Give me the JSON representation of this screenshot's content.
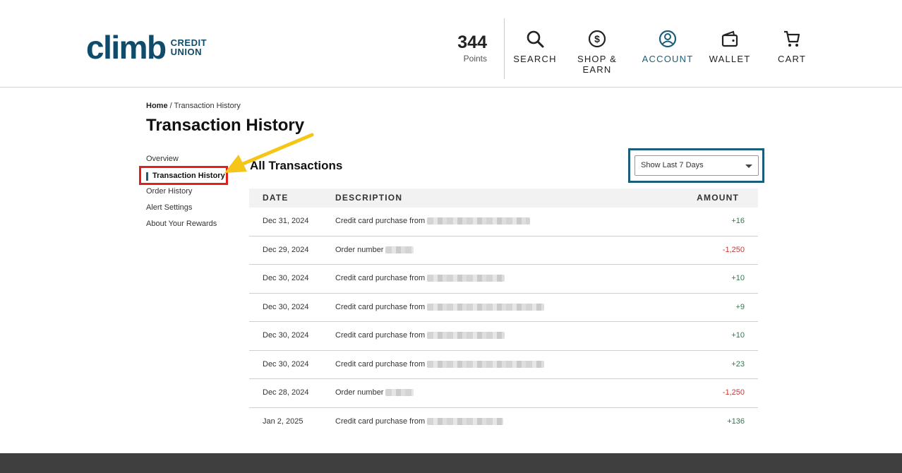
{
  "logo": {
    "main": "climb",
    "sub_line1": "CREDIT",
    "sub_line2": "UNION"
  },
  "points": {
    "value": "344",
    "label": "Points"
  },
  "nav": [
    {
      "label": "SEARCH",
      "icon": "search-icon"
    },
    {
      "label": "SHOP &\nEARN",
      "icon": "dollar-coin-icon"
    },
    {
      "label": "ACCOUNT",
      "icon": "user-circle-icon",
      "active": true
    },
    {
      "label": "WALLET",
      "icon": "wallet-icon"
    },
    {
      "label": "CART",
      "icon": "cart-icon"
    }
  ],
  "breadcrumb": {
    "home": "Home",
    "separator": " / ",
    "current": "Transaction History"
  },
  "page_title": "Transaction History",
  "sidebar": {
    "items": [
      {
        "label": "Overview"
      },
      {
        "label": "Transaction History",
        "active": true
      },
      {
        "label": "Order History"
      },
      {
        "label": "Alert Settings"
      },
      {
        "label": "About Your Rewards"
      }
    ]
  },
  "section_title": "All Transactions",
  "filter": {
    "selected": "Show Last 7 Days"
  },
  "table": {
    "headers": {
      "date": "DATE",
      "description": "DESCRIPTION",
      "amount": "AMOUNT"
    },
    "rows": [
      {
        "date": "Dec 31, 2024",
        "description": "Credit card purchase from",
        "amount": "+16"
      },
      {
        "date": "Dec 29, 2024",
        "description": "Order number",
        "amount": "-1,250"
      },
      {
        "date": "Dec 30, 2024",
        "description": "Credit card purchase from",
        "amount": "+10"
      },
      {
        "date": "Dec 30, 2024",
        "description": "Credit card purchase from",
        "amount": "+9"
      },
      {
        "date": "Dec 30, 2024",
        "description": "Credit card purchase from",
        "amount": "+10"
      },
      {
        "date": "Dec 30, 2024",
        "description": "Credit card purchase from",
        "amount": "+23"
      },
      {
        "date": "Dec 28, 2024",
        "description": "Order number",
        "amount": "-1,250"
      },
      {
        "date": "Jan 2, 2025",
        "description": "Credit card purchase from",
        "amount": "+136"
      }
    ]
  },
  "colors": {
    "brand": "#0f4c6c",
    "accent": "#1b5e7a",
    "positive": "#2e7a4e",
    "negative": "#c43a3a",
    "highlight_box": "#e0201c",
    "annotation_arrow": "#f5c518",
    "footer": "#3f3f3f"
  }
}
